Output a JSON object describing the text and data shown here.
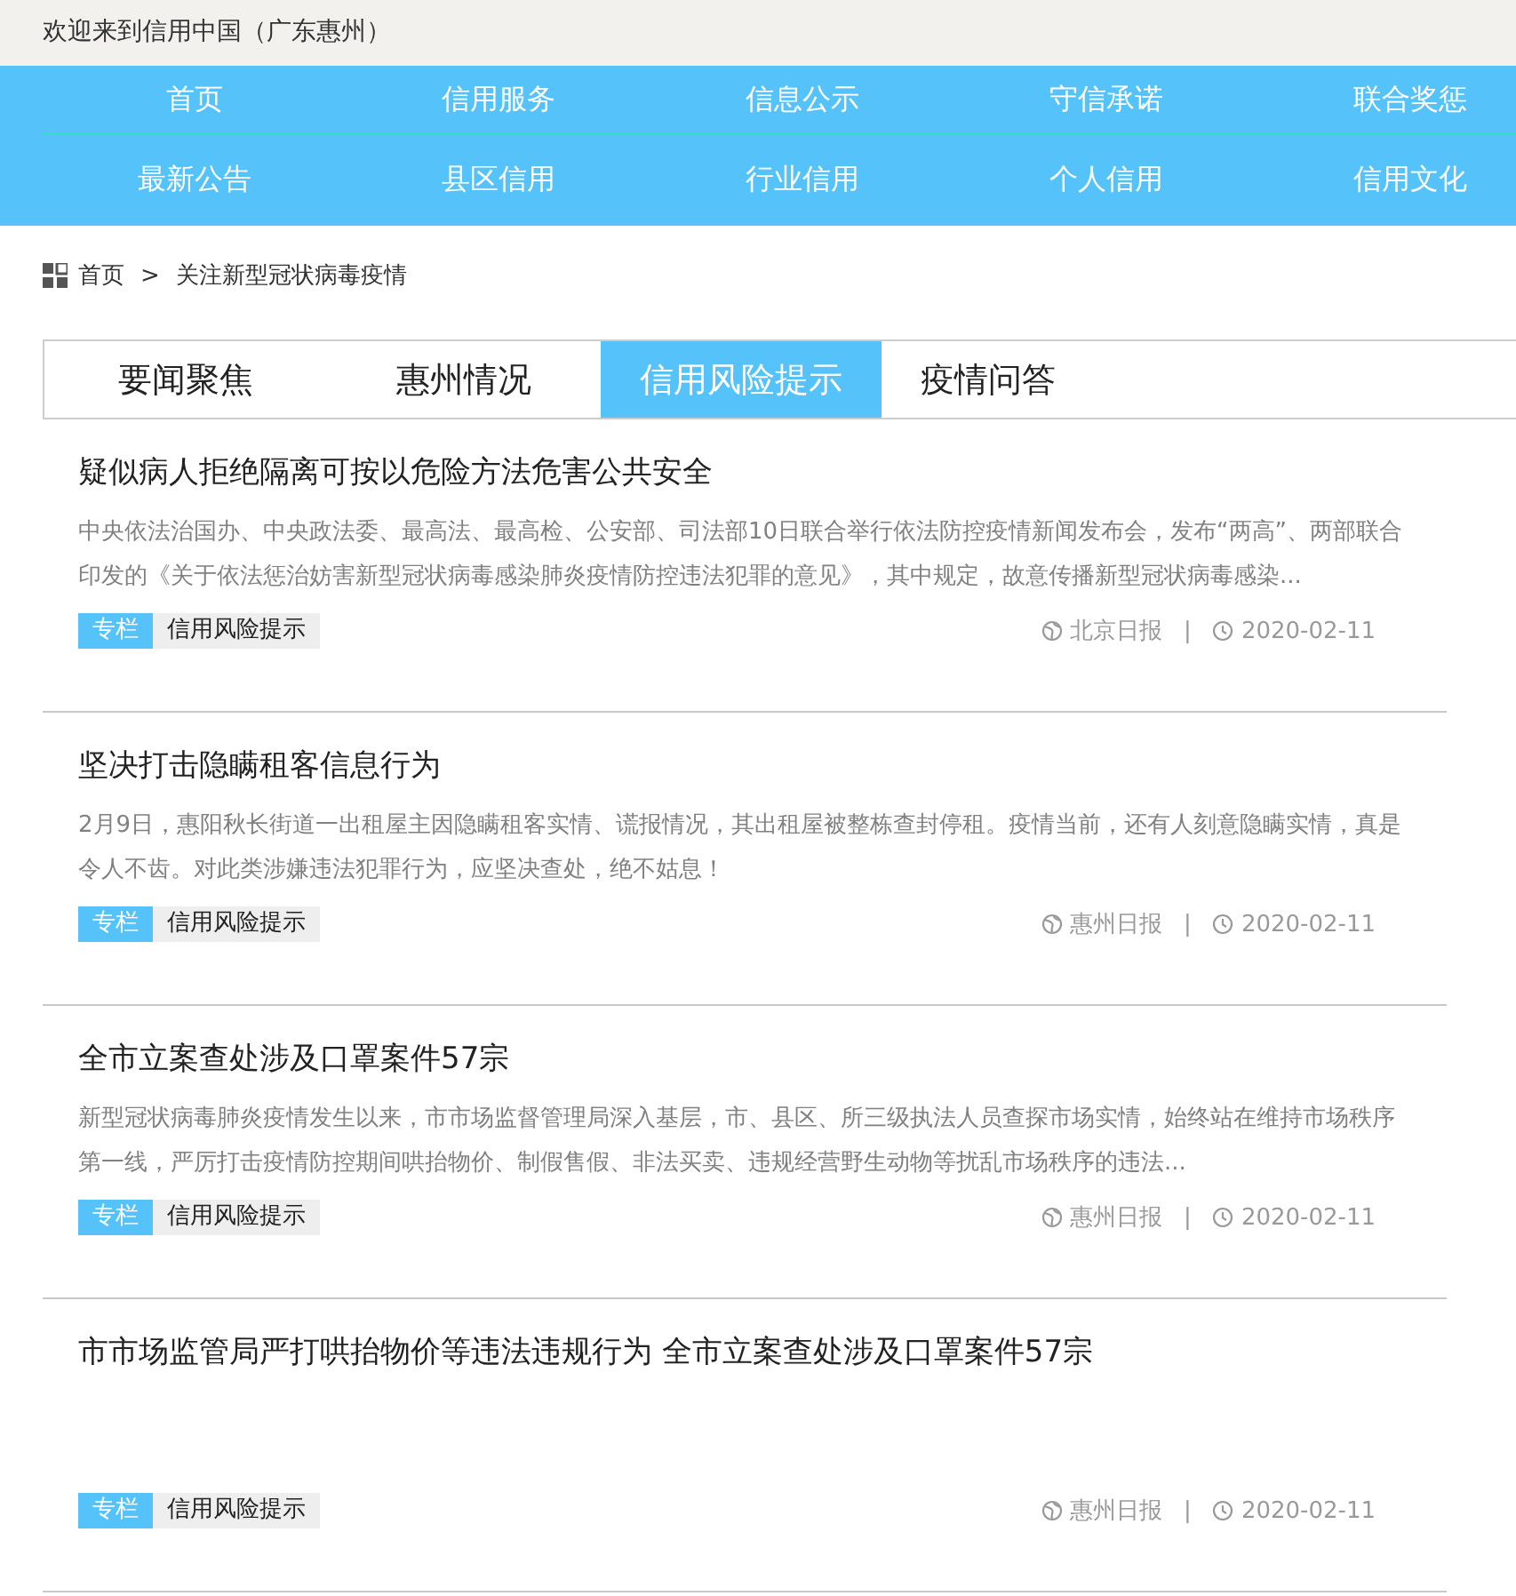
{
  "top_bar": {
    "welcome": "欢迎来到信用中国（广东惠州）"
  },
  "nav": {
    "rows": [
      [
        "首页",
        "信用服务",
        "信息公示",
        "守信承诺",
        "联合奖惩"
      ],
      [
        "最新公告",
        "县区信用",
        "行业信用",
        "个人信用",
        "信用文化"
      ]
    ]
  },
  "breadcrumb": {
    "items": [
      "首页",
      "关注新型冠状病毒疫情"
    ],
    "separator": ">"
  },
  "tabs": [
    {
      "label": "要闻聚焦",
      "selected": false
    },
    {
      "label": "惠州情况",
      "selected": false
    },
    {
      "label": "信用风险提示",
      "selected": true
    },
    {
      "label": "疫情问答",
      "selected": false
    }
  ],
  "articles": [
    {
      "title": "疑似病人拒绝隔离可按以危险方法危害公共安全",
      "summary": "中央依法治国办、中央政法委、最高法、最高检、公安部、司法部10日联合举行依法防控疫情新闻发布会，发布“两高”、两部联合印发的《关于依法惩治妨害新型冠状病毒感染肺炎疫情防控违法犯罪的意见》，其中规定，故意传播新型冠状病毒感染...",
      "tags": [
        {
          "label": "专栏",
          "kind": "column"
        },
        {
          "label": "信用风险提示",
          "kind": "category"
        }
      ],
      "source": "北京日报",
      "separator": "|",
      "date": "2020-02-11"
    },
    {
      "title": "坚决打击隐瞒租客信息行为",
      "summary": "2月9日，惠阳秋长街道一出租屋主因隐瞒租客实情、谎报情况，其出租屋被整栋查封停租。疫情当前，还有人刻意隐瞒实情，真是令人不齿。对此类涉嫌违法犯罪行为，应坚决查处，绝不姑息！",
      "tags": [
        {
          "label": "专栏",
          "kind": "column"
        },
        {
          "label": "信用风险提示",
          "kind": "category"
        }
      ],
      "source": "惠州日报",
      "separator": "|",
      "date": "2020-02-11"
    },
    {
      "title": "全市立案查处涉及口罩案件57宗",
      "summary": "新型冠状病毒肺炎疫情发生以来，市市场监督管理局深入基层，市、县区、所三级执法人员查探市场实情，始终站在维持市场秩序第一线，严厉打击疫情防控期间哄抬物价、制假售假、非法买卖、违规经营野生动物等扰乱市场秩序的违法...",
      "tags": [
        {
          "label": "专栏",
          "kind": "column"
        },
        {
          "label": "信用风险提示",
          "kind": "category"
        }
      ],
      "source": "惠州日报",
      "separator": "|",
      "date": "2020-02-11"
    },
    {
      "title": "市市场监管局严打哄抬物价等违法违规行为 全市立案查处涉及口罩案件57宗",
      "tags": [
        {
          "label": "专栏",
          "kind": "column"
        },
        {
          "label": "信用风险提示",
          "kind": "category"
        }
      ],
      "source": "惠州日报",
      "separator": "|",
      "date": "2020-02-11"
    }
  ]
}
